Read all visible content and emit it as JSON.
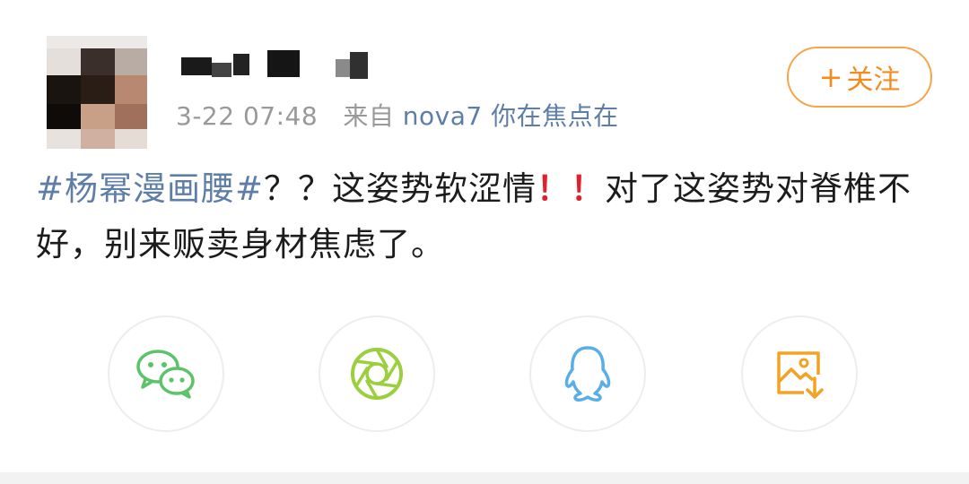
{
  "post": {
    "meta": {
      "time": "3-22 07:48",
      "source_prefix": "来自",
      "source": "nova7 你在焦点在"
    },
    "follow_label": "关注",
    "follow_plus": "+",
    "hashtag": "#杨幂漫画腰#",
    "text_part1": "？？这姿势软涩情",
    "exclaim1": "！",
    "exclaim2": "！",
    "text_part2": "对了这姿势对脊椎不好，别来贩卖身材焦虑了。"
  },
  "share": {
    "items": [
      {
        "name": "wechat",
        "icon": "wechat-icon",
        "color": "#5cc36a"
      },
      {
        "name": "moments",
        "icon": "camera-aperture-icon",
        "color": "#9bcf3e"
      },
      {
        "name": "qq",
        "icon": "qq-penguin-icon",
        "color": "#5aaee8"
      },
      {
        "name": "save-image",
        "icon": "image-download-icon",
        "color": "#f3a324"
      }
    ]
  }
}
